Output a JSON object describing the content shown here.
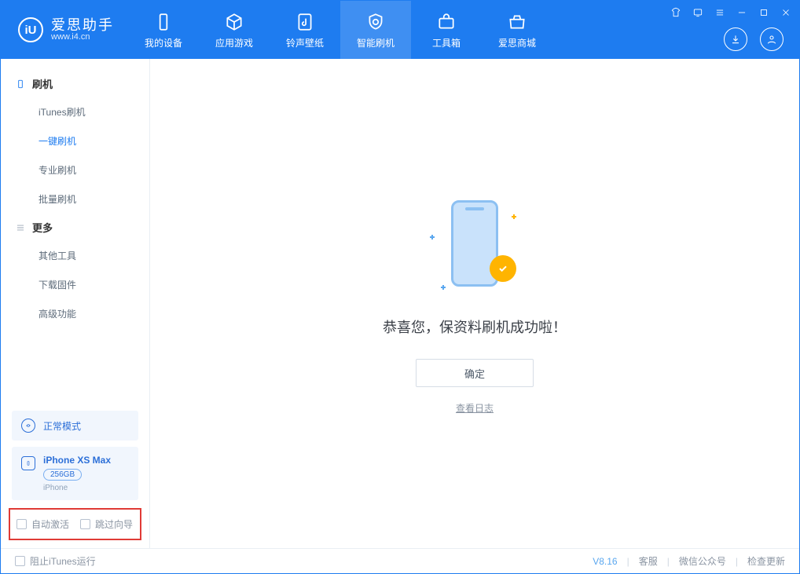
{
  "brand": {
    "title": "爱思助手",
    "subtitle": "www.i4.cn"
  },
  "nav": {
    "device": "我的设备",
    "apps": "应用游戏",
    "ring": "铃声壁纸",
    "flash": "智能刷机",
    "tools": "工具箱",
    "store": "爱思商城"
  },
  "sidebar": {
    "group_flash": "刷机",
    "items_flash": {
      "itunes": "iTunes刷机",
      "oneclick": "一键刷机",
      "pro": "专业刷机",
      "batch": "批量刷机"
    },
    "group_more": "更多",
    "items_more": {
      "other": "其他工具",
      "firmware": "下载固件",
      "advanced": "高级功能"
    }
  },
  "mode_label": "正常模式",
  "device": {
    "name": "iPhone XS Max",
    "storage": "256GB",
    "type": "iPhone"
  },
  "checks": {
    "auto_activate": "自动激活",
    "skip_wizard": "跳过向导"
  },
  "main": {
    "message": "恭喜您，保资料刷机成功啦！",
    "ok": "确定",
    "log": "查看日志"
  },
  "status": {
    "block_itunes": "阻止iTunes运行",
    "version": "V8.16",
    "cs": "客服",
    "wx": "微信公众号",
    "update": "检查更新"
  }
}
